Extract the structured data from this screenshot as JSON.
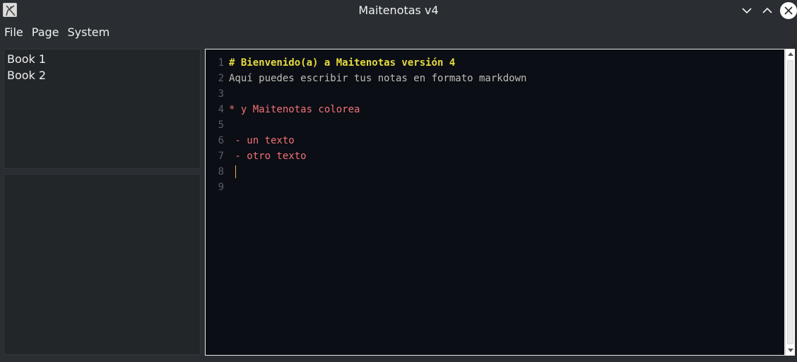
{
  "window": {
    "title": "Maitenotas v4",
    "icons": [
      "app-icon",
      "minimize-icon",
      "maximize-icon",
      "close-icon"
    ]
  },
  "menu": {
    "items": [
      "File",
      "Page",
      "System"
    ]
  },
  "books": {
    "items": [
      "Book 1",
      "Book 2"
    ]
  },
  "editor": {
    "line_numbers": [
      "1",
      "2",
      "3",
      "4",
      "5",
      "6",
      "7",
      "8",
      "9"
    ],
    "lines": [
      "# Bienvenido(a) a Maitenotas versión 4",
      "Aquí puedes escribir tus notas en formato markdown",
      "",
      "* y Maitenotas colorea",
      "",
      " - un texto",
      " - otro texto",
      "",
      ""
    ],
    "colors": {
      "background": "#0b0e14",
      "heading": "#e6db40",
      "text": "#bfbdb6",
      "bullet": "#f07178",
      "caret": "#e6b450"
    }
  }
}
